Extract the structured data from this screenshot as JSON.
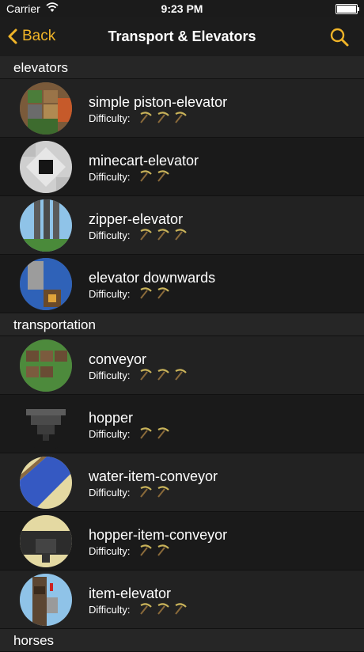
{
  "status": {
    "carrier": "Carrier",
    "time": "9:23 PM"
  },
  "nav": {
    "back_label": "Back",
    "title": "Transport & Elevators"
  },
  "sections": [
    {
      "label": "elevators"
    },
    {
      "label": "transportation"
    },
    {
      "label": "horses"
    }
  ],
  "difficulty_label": "Difficulty:",
  "items": [
    {
      "name": "simple piston-elevator",
      "difficulty": 3
    },
    {
      "name": "minecart-elevator",
      "difficulty": 2
    },
    {
      "name": "zipper-elevator",
      "difficulty": 3
    },
    {
      "name": "elevator downwards",
      "difficulty": 2
    },
    {
      "name": "conveyor",
      "difficulty": 3
    },
    {
      "name": "hopper",
      "difficulty": 2
    },
    {
      "name": "water-item-conveyor",
      "difficulty": 2
    },
    {
      "name": "hopper-item-conveyor",
      "difficulty": 2
    },
    {
      "name": "item-elevator",
      "difficulty": 3
    }
  ],
  "colors": {
    "accent": "#f0b428",
    "pickaxe": "#c9b35a"
  }
}
